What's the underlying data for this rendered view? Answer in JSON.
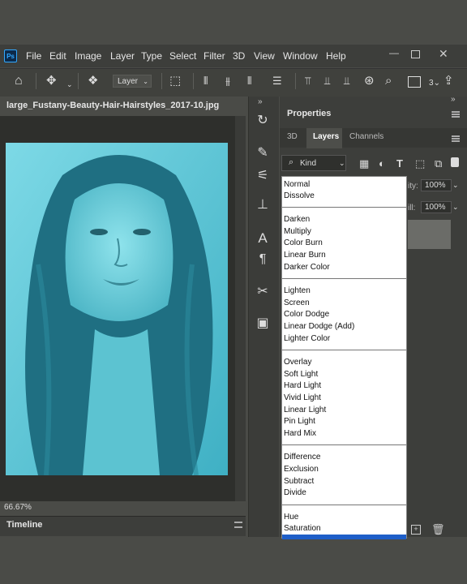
{
  "menubar": {
    "items": [
      "File",
      "Edit",
      "Image",
      "Layer",
      "Type",
      "Select",
      "Filter",
      "3D",
      "View",
      "Window",
      "Help"
    ],
    "app_icon": "ps-logo",
    "window_controls": [
      "minimize-icon",
      "restore-icon",
      "close-icon"
    ]
  },
  "options_bar": {
    "layer_select_value": "Layer",
    "zoom_number": "3"
  },
  "document": {
    "title": "large_Fustany-Beauty-Hair-Hairstyles_2017-10.jpg",
    "zoom": "66.67%"
  },
  "timeline": {
    "label": "Timeline"
  },
  "properties": {
    "label": "Properties"
  },
  "layers_panel": {
    "tabs": [
      "3D",
      "Layers",
      "Channels"
    ],
    "active_tab": "Layers",
    "filter_kind": "Kind",
    "opacity_label": "ity:",
    "opacity_value": "100%",
    "fill_label": "ill:",
    "fill_value": "100%"
  },
  "blend_modes": {
    "groups": [
      [
        "Normal",
        "Dissolve"
      ],
      [
        "Darken",
        "Multiply",
        "Color Burn",
        "Linear Burn",
        "Darker Color"
      ],
      [
        "Lighten",
        "Screen",
        "Color Dodge",
        "Linear Dodge (Add)",
        "Lighter Color"
      ],
      [
        "Overlay",
        "Soft Light",
        "Hard Light",
        "Vivid Light",
        "Linear Light",
        "Pin Light",
        "Hard Mix"
      ],
      [
        "Difference",
        "Exclusion",
        "Subtract",
        "Divide"
      ],
      [
        "Hue",
        "Saturation"
      ]
    ]
  },
  "colors": {
    "photo_tint": "#56c4d3",
    "ps_blue": "#31a8ff",
    "highlight": "#1e5ec8"
  }
}
